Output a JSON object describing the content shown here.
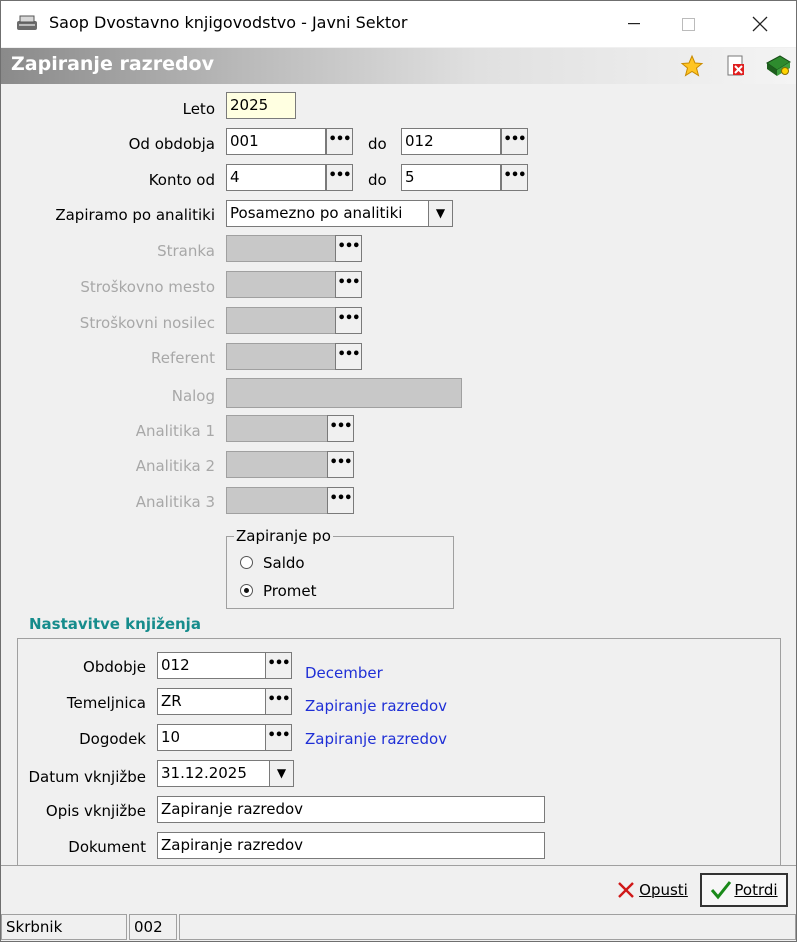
{
  "window": {
    "title": "Saop Dvostavno knjigovodstvo - Javni Sektor",
    "minimize_icon": "minimize-icon",
    "maximize_icon": "maximize-icon",
    "close_icon": "close-icon"
  },
  "header": {
    "title": "Zapiranje razredov",
    "icons": [
      "star-icon",
      "delete-document-icon",
      "help-book-icon"
    ]
  },
  "form": {
    "leto": {
      "label": "Leto",
      "value": "2025"
    },
    "od_obdobja": {
      "label": "Od obdobja",
      "value": "001",
      "do_label": "do",
      "do_value": "012"
    },
    "konto_od": {
      "label": "Konto od",
      "value": "4",
      "do_label": "do",
      "do_value": "5"
    },
    "zapiramo": {
      "label": "Zapiramo po analitiki",
      "value": "Posamezno po analitiki"
    },
    "stranka": {
      "label": "Stranka",
      "value": ""
    },
    "stroskovno_mesto": {
      "label": "Stroškovno mesto",
      "value": ""
    },
    "stroskovni_nosilec": {
      "label": "Stroškovni nosilec",
      "value": ""
    },
    "referent": {
      "label": "Referent",
      "value": ""
    },
    "nalog": {
      "label": "Nalog",
      "value": ""
    },
    "analitika1": {
      "label": "Analitika 1",
      "value": ""
    },
    "analitika2": {
      "label": "Analitika 2",
      "value": ""
    },
    "analitika3": {
      "label": "Analitika 3",
      "value": ""
    },
    "dots": "•••"
  },
  "zapiranje_po": {
    "title": "Zapiranje po",
    "options": [
      {
        "label": "Saldo",
        "selected": false
      },
      {
        "label": "Promet",
        "selected": true
      }
    ]
  },
  "nastavitve": {
    "title": "Nastavitve knjiženja",
    "obdobje": {
      "label": "Obdobje",
      "value": "012",
      "desc": "December"
    },
    "temeljnica": {
      "label": "Temeljnica",
      "value": "ZR",
      "desc": "Zapiranje razredov"
    },
    "dogodek": {
      "label": "Dogodek",
      "value": "10",
      "desc": "Zapiranje razredov"
    },
    "datum": {
      "label": "Datum vknjižbe",
      "value": "31.12.2025"
    },
    "opis": {
      "label": "Opis vknjižbe",
      "value": "Zapiranje razredov"
    },
    "dokument": {
      "label": "Dokument",
      "value": "Zapiranje razredov"
    }
  },
  "buttons": {
    "opusti": "Opusti",
    "potrdi": "Potrdi"
  },
  "status": {
    "user": "Skrbnik",
    "code": "002"
  },
  "colors": {
    "link": "#1f2fd6",
    "section": "#168c8c",
    "yellow_input": "#ffffe1"
  }
}
